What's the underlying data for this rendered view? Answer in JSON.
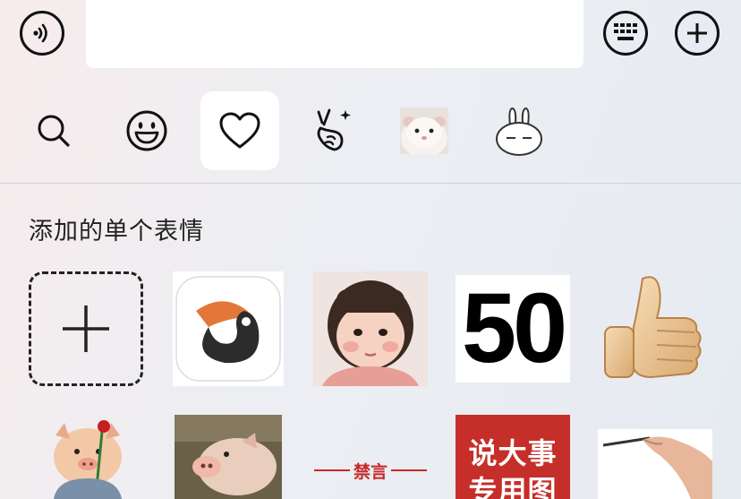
{
  "topbar": {
    "voice_button": "voice-button",
    "input_value": "",
    "keyboard_button": "keyboard-button",
    "add_button": "add-button"
  },
  "tabs": [
    {
      "icon": "search-icon",
      "active": false
    },
    {
      "icon": "smiley-icon",
      "active": false
    },
    {
      "icon": "heart-icon",
      "active": true
    },
    {
      "icon": "peace-hand-icon",
      "active": false
    },
    {
      "icon": "hamster-sticker",
      "active": false
    },
    {
      "icon": "rabbit-sticker",
      "active": false
    }
  ],
  "section": {
    "title": "添加的单个表情"
  },
  "stickers": {
    "row1": [
      {
        "name": "add-sticker"
      },
      {
        "name": "toucan-app-logo"
      },
      {
        "name": "chubby-girl-sticker"
      },
      {
        "name": "number-50-sticker",
        "text": "50"
      },
      {
        "name": "thumbs-up-sticker"
      }
    ],
    "row2": [
      {
        "name": "pig-with-rose-sticker"
      },
      {
        "name": "pig-photo-sticker"
      },
      {
        "name": "forbidden-words-sticker",
        "text": "禁言"
      },
      {
        "name": "big-news-sticker",
        "text_line1": "说大事",
        "text_line2": "专用图"
      },
      {
        "name": "hand-writing-sticker"
      }
    ]
  }
}
